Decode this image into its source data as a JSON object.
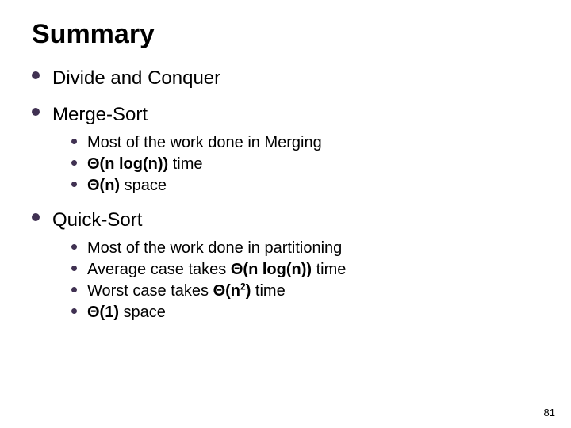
{
  "title": "Summary",
  "bullets": [
    {
      "text": "Divide and Conquer"
    },
    {
      "text": "Merge-Sort",
      "sub": [
        {
          "text": "Most of the work done in Merging"
        },
        {
          "html": "<span class='b'>Θ(n log(n))</span> time"
        },
        {
          "html": "<span class='b'>Θ(n)</span> space"
        }
      ]
    },
    {
      "text": "Quick-Sort",
      "sub": [
        {
          "text": "Most of the work done in partitioning"
        },
        {
          "html": "Average case takes <span class='b'>Θ(n log(n))</span> time"
        },
        {
          "html": "Worst case takes <span class='b'>Θ(n<sup>2</sup>)</span> time"
        },
        {
          "html": "<span class='b'>Θ(1)</span> space"
        }
      ]
    }
  ],
  "page_number": "81"
}
